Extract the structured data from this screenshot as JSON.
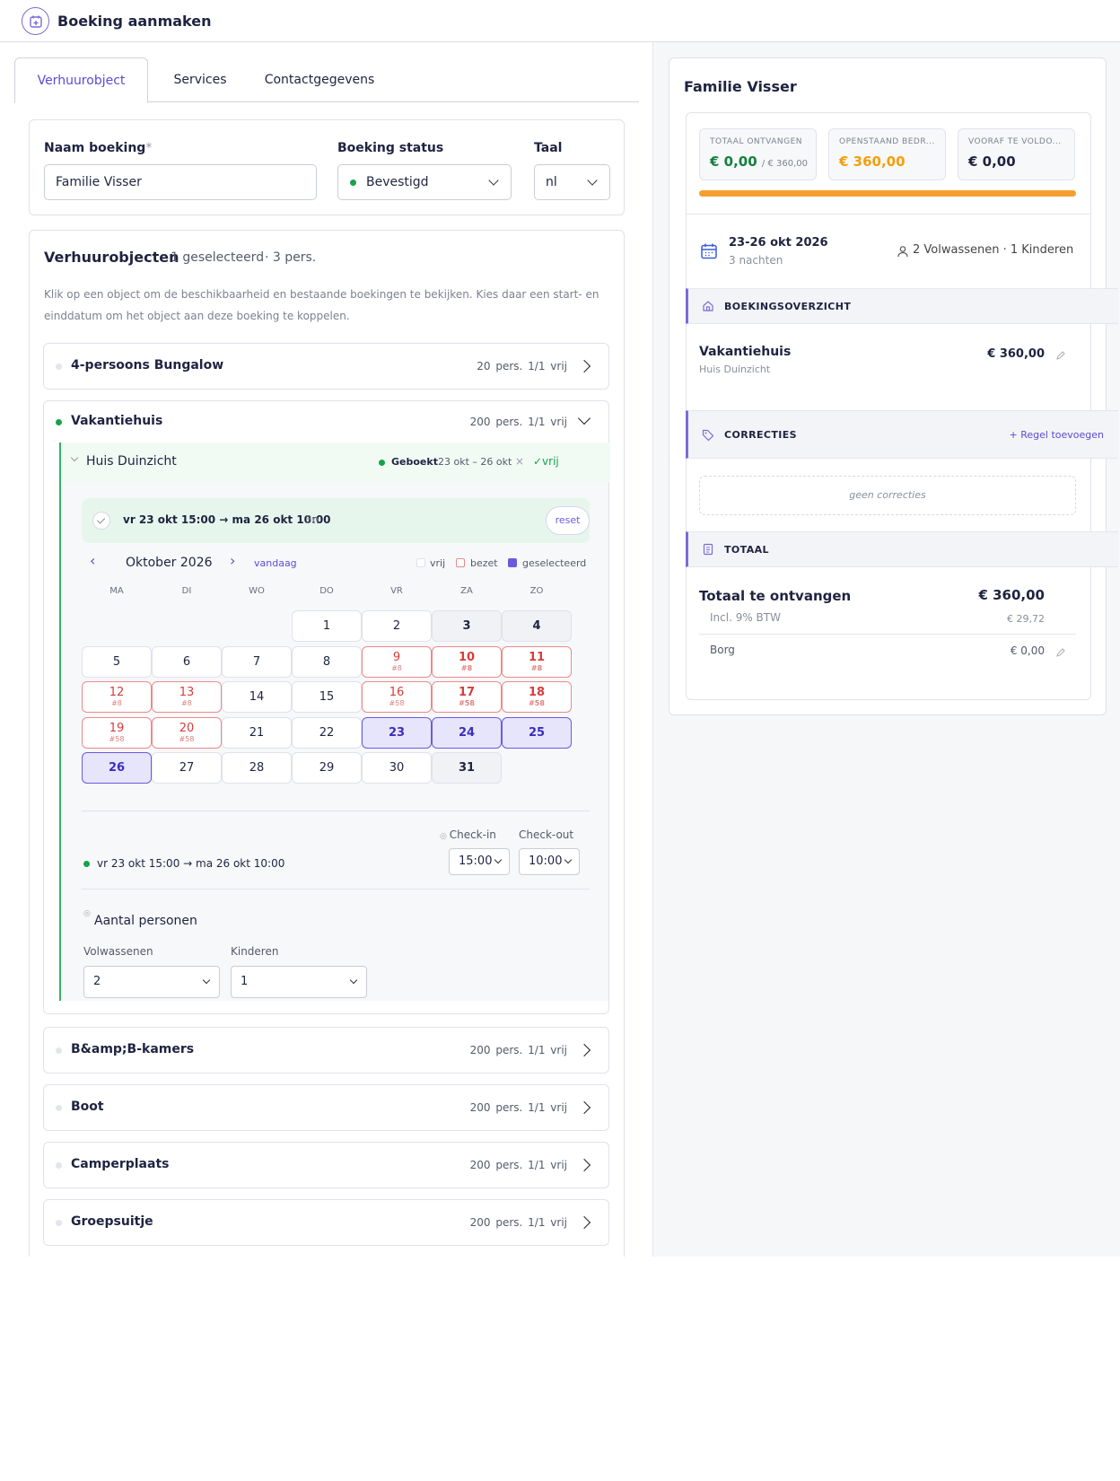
{
  "header": {
    "title": "Boeking aanmaken",
    "icon": "calendar-plus-icon"
  },
  "tabs": [
    "Verhuurobject",
    "Services",
    "Contactgegevens"
  ],
  "form": {
    "name_label": "Naam boeking",
    "required_mark": "*",
    "name_value": "Familie Visser",
    "status_label": "Boeking status",
    "status_value": "Bevestigd",
    "status_color": "#16a34a",
    "lang_label": "Taal",
    "lang_value": "nl"
  },
  "objects": {
    "title": "Verhuurobjecten",
    "selected": "1 geselecteerd",
    "persons": "· 3 pers.",
    "help": "Klik op een object om de beschikbaarheid en bestaande boekingen te bekijken. Kies daar een start- en einddatum om het object aan deze boeking te koppelen.",
    "rows": [
      {
        "name": "4-persoons Bungalow",
        "meta": "20 pers.  1/1 vrij"
      },
      {
        "name": "Vakantiehuis",
        "meta": "200 pers.  1/1 vrij"
      },
      {
        "name": "B&amp;B-kamers",
        "meta": "200 pers.  1/1 vrij"
      },
      {
        "name": "Boot",
        "meta": "200 pers.  1/1 vrij"
      },
      {
        "name": "Camperplaats",
        "meta": "200 pers.  1/1 vrij"
      },
      {
        "name": "Groepsuitje",
        "meta": "200 pers.  1/1 vrij"
      }
    ],
    "unit": {
      "name": "Huis Duinzicht",
      "status": "Geboekt",
      "range": "23 okt – 26 okt",
      "remove": "×",
      "free": "✓vrij"
    },
    "selection": {
      "text": "vr 23 okt 15:00 → ma 26 okt 10:00",
      "nights": "3n",
      "reset": "reset"
    },
    "calendar": {
      "prev": "‹",
      "next": "›",
      "month": "Oktober 2026",
      "today": "vandaag",
      "legend": [
        "vrij",
        "bezet",
        "geselecteerd"
      ],
      "weekdays": [
        "MA",
        "DI",
        "WO",
        "DO",
        "VR",
        "ZA",
        "ZO"
      ],
      "days": [
        {
          "d": "1",
          "s": ""
        },
        {
          "d": "2",
          "s": ""
        },
        {
          "d": "3",
          "s": ""
        },
        {
          "d": "4",
          "s": ""
        },
        {
          "d": "5",
          "s": ""
        },
        {
          "d": "6",
          "s": ""
        },
        {
          "d": "7",
          "s": ""
        },
        {
          "d": "8",
          "s": ""
        },
        {
          "d": "9",
          "s": "#8"
        },
        {
          "d": "10",
          "s": "#8"
        },
        {
          "d": "11",
          "s": "#8"
        },
        {
          "d": "12",
          "s": "#8"
        },
        {
          "d": "13",
          "s": "#8"
        },
        {
          "d": "14",
          "s": ""
        },
        {
          "d": "15",
          "s": ""
        },
        {
          "d": "16",
          "s": "#58"
        },
        {
          "d": "17",
          "s": "#58"
        },
        {
          "d": "18",
          "s": "#58"
        },
        {
          "d": "19",
          "s": "#58"
        },
        {
          "d": "20",
          "s": "#58"
        },
        {
          "d": "21",
          "s": ""
        },
        {
          "d": "22",
          "s": ""
        },
        {
          "d": "23",
          "s": ""
        },
        {
          "d": "24",
          "s": ""
        },
        {
          "d": "25",
          "s": ""
        },
        {
          "d": "26",
          "s": ""
        },
        {
          "d": "27",
          "s": ""
        },
        {
          "d": "28",
          "s": ""
        },
        {
          "d": "29",
          "s": ""
        },
        {
          "d": "30",
          "s": ""
        },
        {
          "d": "31",
          "s": ""
        }
      ]
    },
    "times": {
      "checkin_label": "Check-in",
      "checkout_label": "Check-out",
      "checkin": "15:00",
      "checkout": "10:00",
      "summary": "vr 23 okt 15:00 → ma 26 okt 10:00"
    },
    "persons_block": {
      "title": "Aantal personen",
      "adults_label": "Volwassenen",
      "children_label": "Kinderen",
      "adults": "2",
      "children": "1"
    }
  },
  "summary": {
    "name": "Familie Visser",
    "stats": [
      {
        "label": "TOTAAL ONTVANGEN",
        "value": "€ 0,00",
        "extra": "/ € 360,00",
        "color": "#15803d"
      },
      {
        "label": "OPENSTAAND BEDR...",
        "value": "€ 360,00",
        "color": "#f59e0b"
      },
      {
        "label": "VOORAF TE VOLDO...",
        "value": "€ 0,00",
        "color": "#1f2340"
      }
    ],
    "progress_color": "#f59e2f",
    "dates": "23-26 okt 2026",
    "nights": "3 nachten",
    "guests": "2 Volwassenen · 1 Kinderen",
    "overview_title": "BOEKINGSOVERZICHT",
    "item_name": "Vakantiehuis",
    "item_sub": "Huis Duinzicht",
    "item_price": "€ 360,00",
    "corr_title": "CORRECTIES",
    "add_rule": "+ Regel toevoegen",
    "no_corr": "geen correcties",
    "total_title": "TOTAAL",
    "total_label": "Totaal te ontvangen",
    "total_value": "€ 360,00",
    "vat_label": "Incl. 9% BTW",
    "vat_value": "€ 29,72",
    "deposit_label": "Borg",
    "deposit_value": "€ 0,00"
  }
}
